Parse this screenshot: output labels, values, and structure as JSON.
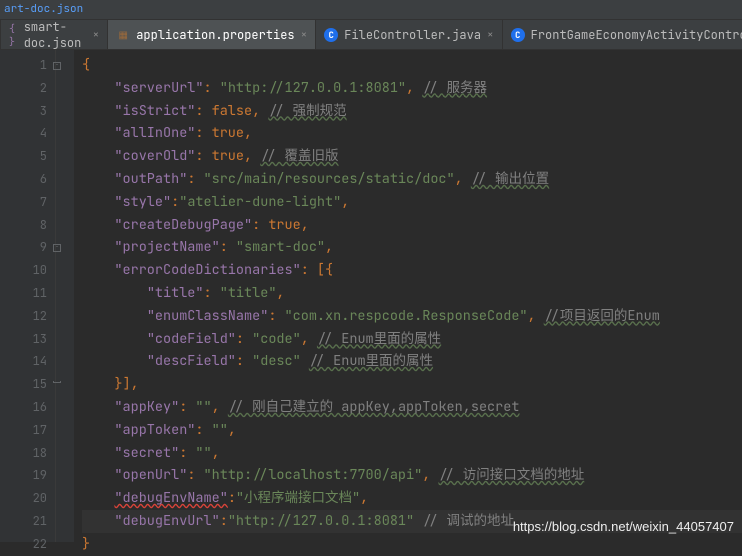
{
  "topbar": {
    "filename": "art-doc.json"
  },
  "tabs": [
    {
      "icon": "json",
      "label": "smart-doc.json",
      "active": false,
      "closable": true
    },
    {
      "icon": "prop",
      "label": "application.properties",
      "active": true,
      "closable": true
    },
    {
      "icon": "java",
      "label": "FileController.java",
      "active": false,
      "closable": true
    },
    {
      "icon": "java",
      "label": "FrontGameEconomyActivityController.jav",
      "active": false,
      "closable": false
    }
  ],
  "gutter": {
    "start": 1,
    "end": 22,
    "error_line": 20,
    "caret_line": 21,
    "fold_open_lines": [
      1,
      9
    ],
    "fold_close_lines": [
      15
    ]
  },
  "code": {
    "l1": "{",
    "l2": {
      "k": "\"serverUrl\"",
      "v": "\"http://127.0.0.1:8081\"",
      "tc": ",",
      "c": "// 服务器"
    },
    "l3": {
      "k": "\"isStrict\"",
      "v": "false",
      "tc": ",",
      "c": "// 强制规范"
    },
    "l4": {
      "k": "\"allInOne\"",
      "v": "true",
      "tc": ","
    },
    "l5": {
      "k": "\"coverOld\"",
      "v": "true",
      "tc": ",",
      "c": "// 覆盖旧版"
    },
    "l6": {
      "k": "\"outPath\"",
      "v": "\"src/main/resources/static/doc\"",
      "tc": ",",
      "c": "// 输出位置"
    },
    "l7": {
      "k": "\"style\"",
      "colonv": "\"atelier-dune-light\"",
      "tc": ","
    },
    "l8": {
      "k": "\"createDebugPage\"",
      "v": "true",
      "tc": ","
    },
    "l9": {
      "k": "\"projectName\"",
      "v": "\"smart-doc\"",
      "tc": ","
    },
    "l10": {
      "k": "\"errorCodeDictionaries\"",
      "after": ": [{"
    },
    "l11": {
      "k": "\"title\"",
      "v": "\"title\"",
      "tc": ","
    },
    "l12": {
      "k": "\"enumClassName\"",
      "v": "\"com.xn.respcode.ResponseCode\"",
      "tc": ",",
      "c": "//项目返回的Enum"
    },
    "l13": {
      "k": "\"codeField\"",
      "v": "\"code\"",
      "tc": ",",
      "c": "// Enum里面的属性"
    },
    "l14": {
      "k": "\"descField\"",
      "v": "\"desc\"",
      "c": "// Enum里面的属性"
    },
    "l15": "}],",
    "l16": {
      "k": "\"appKey\"",
      "v": "\"\"",
      "tc": ",",
      "c": "// 刚自己建立的 appKey,appToken,secret"
    },
    "l17": {
      "k": "\"appToken\"",
      "v": "\"\"",
      "tc": ","
    },
    "l18": {
      "k": "\"secret\"",
      "v": "\"\"",
      "tc": ","
    },
    "l19": {
      "k": "\"openUrl\"",
      "v": "\"http://localhost:7700/api\"",
      "tc": ",",
      "c": "// 访问接口文档的地址"
    },
    "l20": {
      "k": "\"debugEnvName\"",
      "colonv": "\"小程序端接口文档\"",
      "tc": ","
    },
    "l21": {
      "k": "\"debugEnvUrl\"",
      "colonv": "\"http://127.0.0.1:8081\"",
      "c": "// 调试的地址"
    },
    "l22": "}"
  },
  "watermark": "https://blog.csdn.net/weixin_44057407"
}
